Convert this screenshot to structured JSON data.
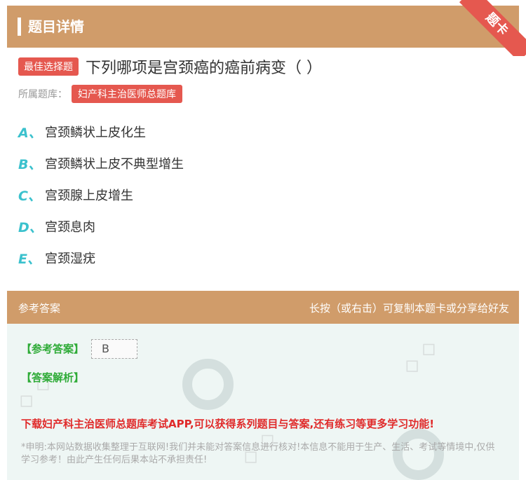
{
  "header": {
    "title": "题目详情",
    "ribbon": "题卡"
  },
  "question": {
    "type_badge": "最佳选择题",
    "text": "下列哪项是宫颈癌的癌前病变（ ）",
    "library_label": "所属题库：",
    "library_name": "妇产科主治医师总题库"
  },
  "options": [
    {
      "letter": "A、",
      "text": "宫颈鳞状上皮化生"
    },
    {
      "letter": "B、",
      "text": "宫颈鳞状上皮不典型增生"
    },
    {
      "letter": "C、",
      "text": "宫颈腺上皮增生"
    },
    {
      "letter": "D、",
      "text": "宫颈息肉"
    },
    {
      "letter": "E、",
      "text": "宫颈湿疣"
    }
  ],
  "answer": {
    "section_label": "参考答案",
    "tip": "长按（或右击）可复制本题卡或分享给好友",
    "key_label": "【参考答案】",
    "key_value": "B",
    "analysis_label": "【答案解析】",
    "promo": "下载妇产科主治医师总题库考试APP,可以获得系列题目与答案,还有练习等更多学习功能!",
    "disclaimer": "*申明:本网站数据收集整理于互联网!我们并未能对答案信息进行核对!本信息不能用于生产、生活、考试等情境中,仅供学习参考！由此产生任何后果本站不承担责任!"
  },
  "colors": {
    "accent": "#d09c6a",
    "badge": "#e5584f",
    "option_letter": "#3bc1cd",
    "answer_green": "#2eab37"
  }
}
